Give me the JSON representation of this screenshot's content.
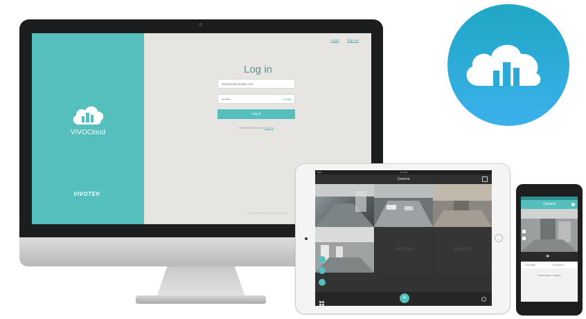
{
  "desktop": {
    "brand_name": "VIVOCloud",
    "company_logo_text": "VIVOTEK",
    "top_links": [
      "Login",
      "Sign up"
    ],
    "login_title": "Log in",
    "email_value": "webuser@vivotek.com",
    "password_value": "••••••••",
    "forgot_label": "Forgot",
    "login_button": "Log in",
    "signup_prompt": "New to VIVOCloud?",
    "signup_link": "Sign up",
    "copyright": "Copyright © VIVOTEK Inc. All rights reserved."
  },
  "tablet": {
    "status_left": "iPad",
    "status_center": "9:41 AM",
    "nav_title": "Camera",
    "camera_watermark": "VIVOTEK",
    "add_button": "+",
    "icons": [
      "grid-icon",
      "gear-icon",
      "layout-icon",
      "camera-icon",
      "dashboard-icon",
      "list-icon"
    ]
  },
  "phone": {
    "nav_title": "Camera",
    "controls": [
      "play-icon"
    ],
    "tab_labels": [
      "LIVE VIEW",
      "PLAYBACK"
    ],
    "camera_label": "Camera name - Location"
  },
  "colors": {
    "brand_teal": "#54bfbd",
    "icon_gradient_top": "#1fa7c4",
    "icon_gradient_bottom": "#3bb0ec",
    "screen_bg": "#e7e5e2"
  }
}
